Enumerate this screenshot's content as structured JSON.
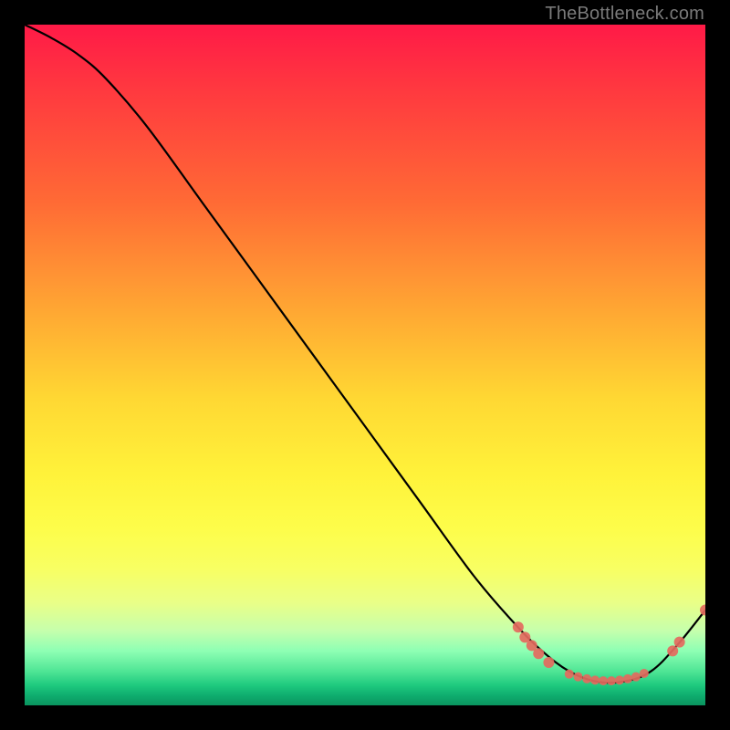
{
  "watermark": "TheBottleneck.com",
  "chart_data": {
    "type": "line",
    "title": "",
    "xlabel": "",
    "ylabel": "",
    "xlim": [
      0,
      100
    ],
    "ylim": [
      0,
      100
    ],
    "grid": false,
    "series": [
      {
        "name": "curve",
        "x": [
          0,
          4,
          8,
          12,
          18,
          26,
          34,
          42,
          50,
          58,
          66,
          72,
          76,
          80,
          84,
          88,
          92,
          96,
          100
        ],
        "y": [
          100,
          98,
          95.5,
          92,
          85,
          74,
          63,
          52,
          41,
          30,
          19,
          12,
          8,
          5,
          3.5,
          3.5,
          5,
          9,
          14
        ]
      }
    ],
    "markers": [
      {
        "x": 72.5,
        "y": 11.5,
        "r": 6
      },
      {
        "x": 73.5,
        "y": 10.0,
        "r": 6
      },
      {
        "x": 74.5,
        "y": 8.8,
        "r": 6
      },
      {
        "x": 75.5,
        "y": 7.6,
        "r": 6
      },
      {
        "x": 77.0,
        "y": 6.3,
        "r": 6
      },
      {
        "x": 80.0,
        "y": 4.6,
        "r": 5
      },
      {
        "x": 81.3,
        "y": 4.2,
        "r": 5
      },
      {
        "x": 82.6,
        "y": 3.9,
        "r": 5
      },
      {
        "x": 83.8,
        "y": 3.7,
        "r": 5
      },
      {
        "x": 85.0,
        "y": 3.6,
        "r": 5
      },
      {
        "x": 86.2,
        "y": 3.6,
        "r": 5
      },
      {
        "x": 87.4,
        "y": 3.7,
        "r": 5
      },
      {
        "x": 88.6,
        "y": 3.9,
        "r": 5
      },
      {
        "x": 89.8,
        "y": 4.2,
        "r": 5
      },
      {
        "x": 91.0,
        "y": 4.7,
        "r": 5
      },
      {
        "x": 95.2,
        "y": 8.0,
        "r": 6
      },
      {
        "x": 96.2,
        "y": 9.3,
        "r": 6
      },
      {
        "x": 100.0,
        "y": 14.0,
        "r": 6
      }
    ],
    "marker_color": "#e46a5e",
    "curve_color": "#000000"
  }
}
